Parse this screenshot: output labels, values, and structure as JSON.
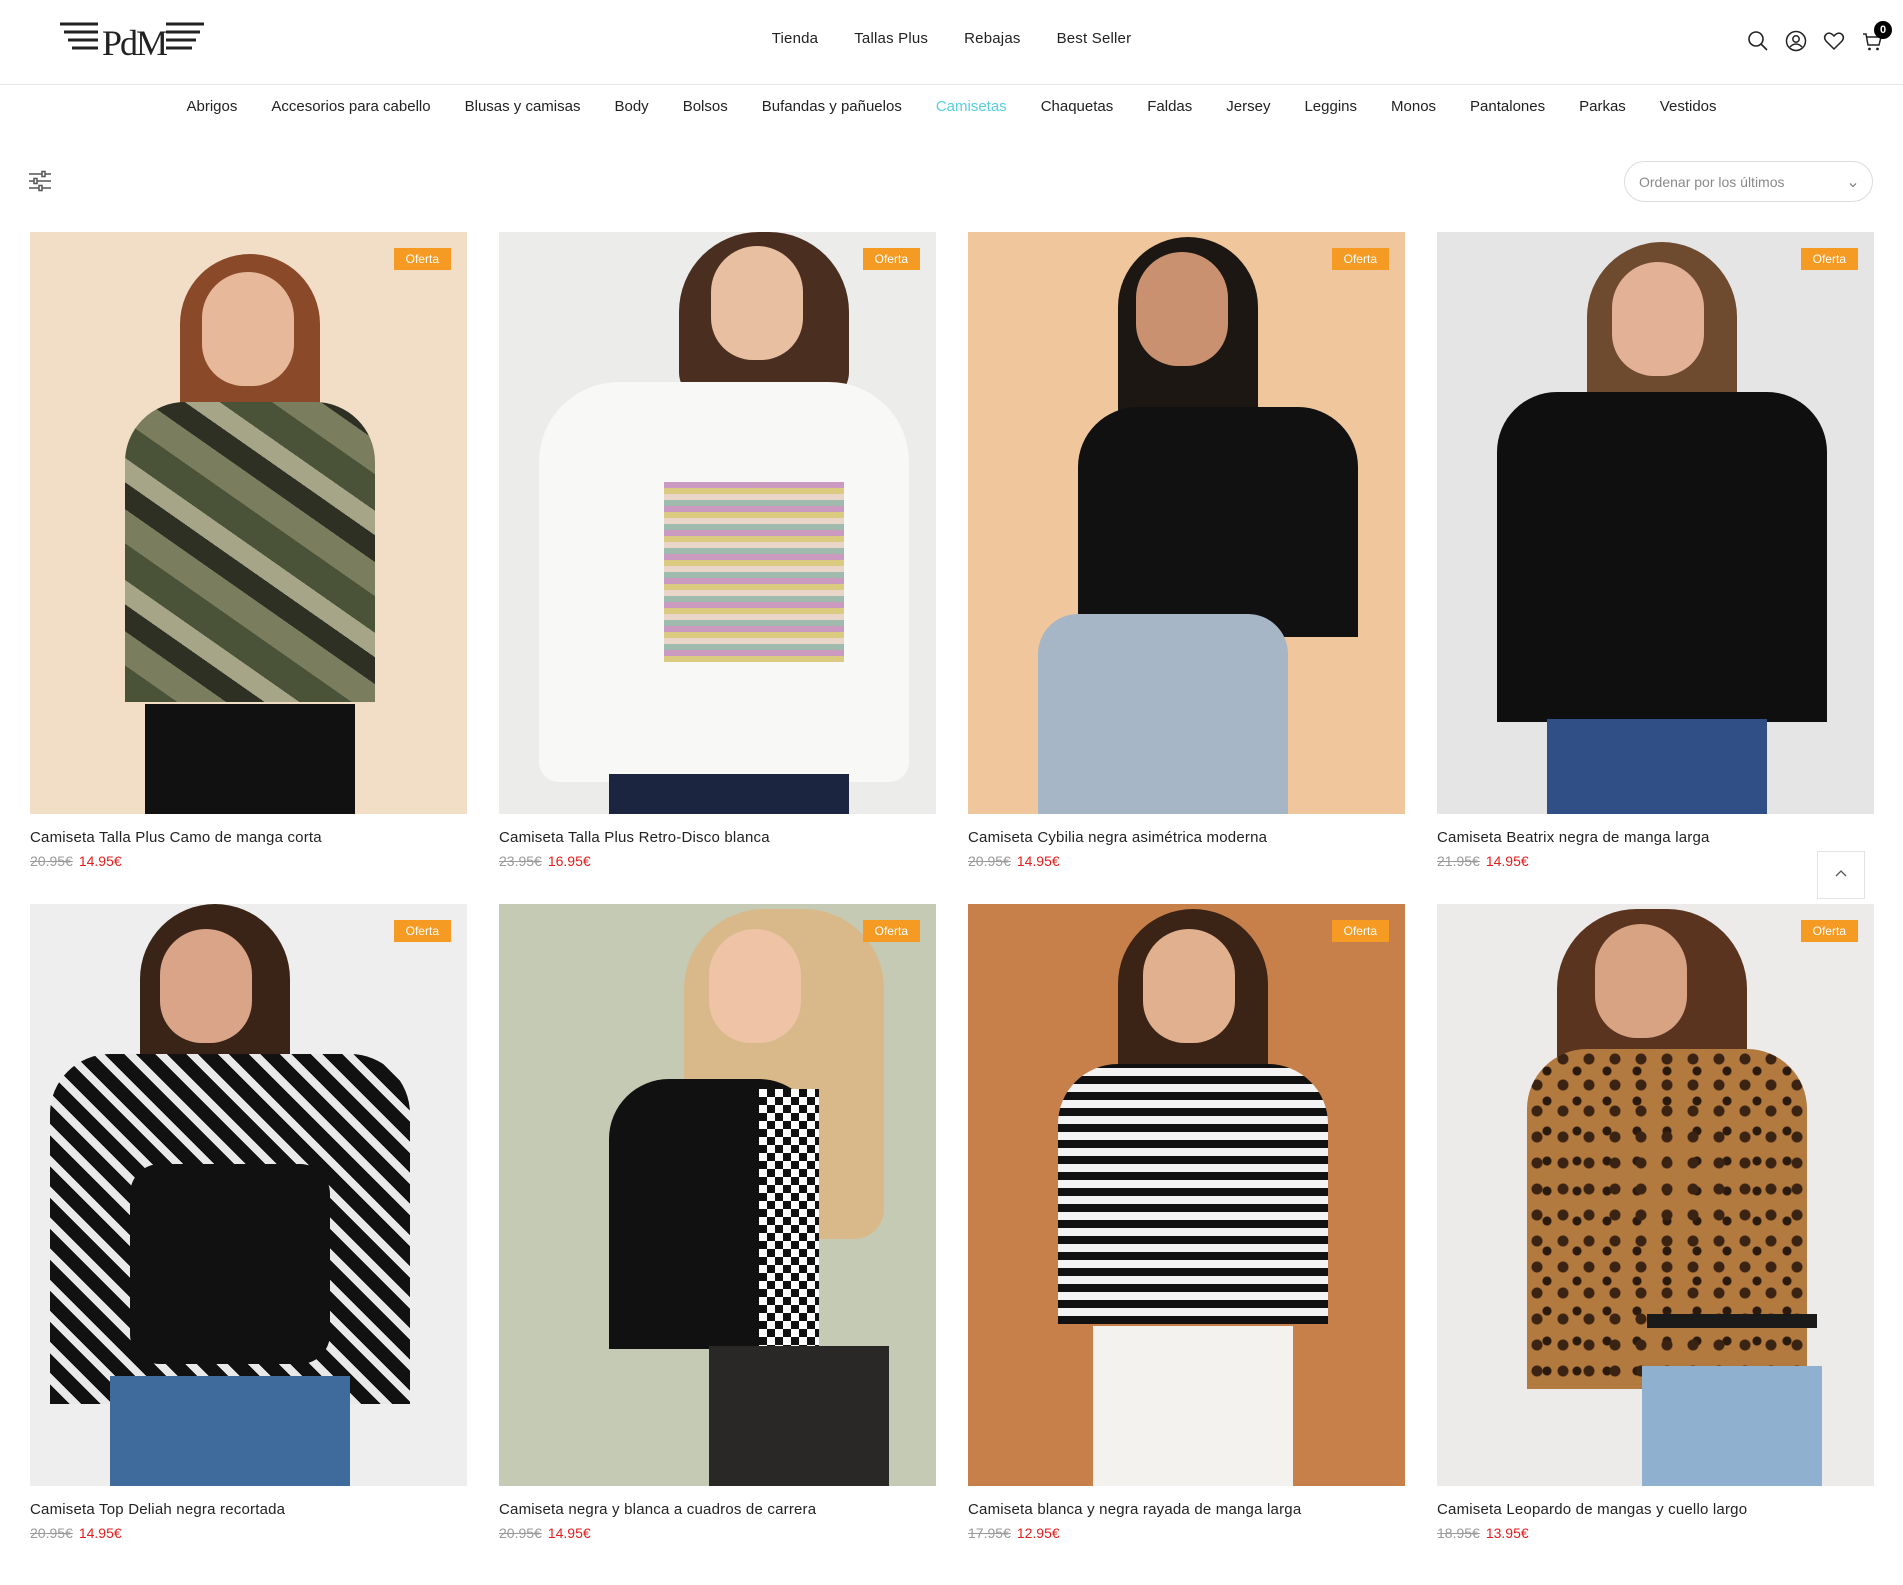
{
  "header": {
    "logo_text": "PdM",
    "nav": [
      "Tienda",
      "Tallas Plus",
      "Rebajas",
      "Best Seller"
    ],
    "icons": [
      "search-icon",
      "user-icon",
      "heart-icon",
      "cart-icon"
    ],
    "cart_count": "0"
  },
  "categories": [
    "Abrigos",
    "Accesorios para cabello",
    "Blusas y camisas",
    "Body",
    "Bolsos",
    "Bufandas y pañuelos",
    "Camisetas",
    "Chaquetas",
    "Faldas",
    "Jersey",
    "Leggins",
    "Monos",
    "Pantalones",
    "Parkas",
    "Vestidos"
  ],
  "active_category": "Camisetas",
  "accent_color": "#56cfe1",
  "toolbar": {
    "sort_label": "Ordenar por los últimos"
  },
  "products": [
    {
      "badge": "Oferta",
      "name": "Camiseta Talla Plus Camo de manga corta",
      "old_price": "20.95€",
      "price": "14.95€"
    },
    {
      "badge": "Oferta",
      "name": "Camiseta Talla Plus Retro-Disco blanca",
      "old_price": "23.95€",
      "price": "16.95€"
    },
    {
      "badge": "Oferta",
      "name": "Camiseta Cybilia negra asimétrica moderna",
      "old_price": "20.95€",
      "price": "14.95€"
    },
    {
      "badge": "Oferta",
      "name": "Camiseta Beatrix negra de manga larga",
      "old_price": "21.95€",
      "price": "14.95€"
    },
    {
      "badge": "Oferta",
      "name": "Camiseta Top Deliah negra recortada",
      "old_price": "20.95€",
      "price": "14.95€"
    },
    {
      "badge": "Oferta",
      "name": "Camiseta negra y blanca a cuadros de carrera",
      "old_price": "20.95€",
      "price": "14.95€"
    },
    {
      "badge": "Oferta",
      "name": "Camiseta blanca y negra rayada de manga larga",
      "old_price": "17.95€",
      "price": "12.95€"
    },
    {
      "badge": "Oferta",
      "name": "Camiseta Leopardo de mangas y cuello largo",
      "old_price": "18.95€",
      "price": "13.95€"
    }
  ]
}
